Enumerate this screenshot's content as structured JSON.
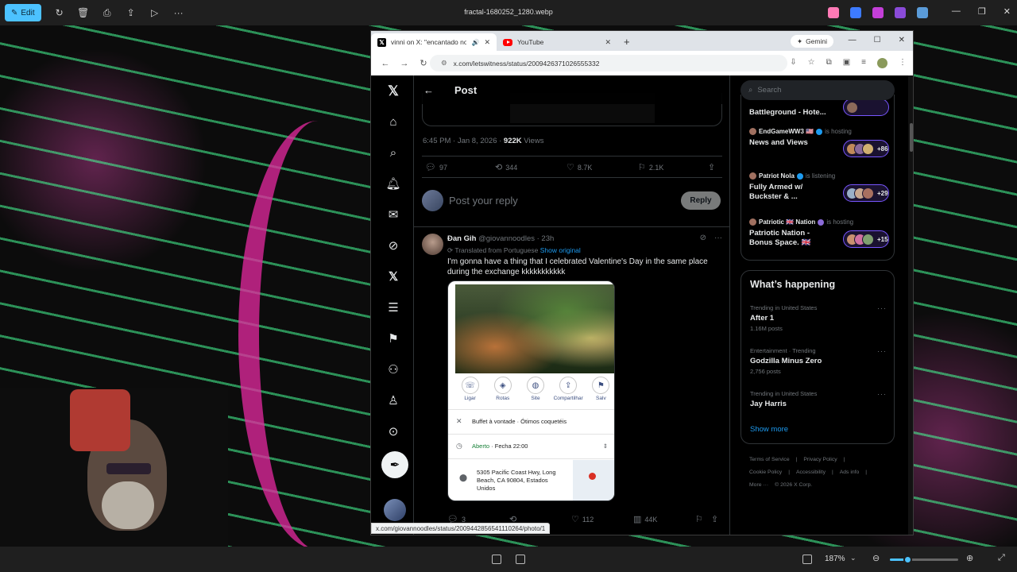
{
  "viewer": {
    "edit_label": "Edit",
    "file_title": "fractal-1680252_1280.webp",
    "zoom_label": "187%",
    "zoom_level": 0.26,
    "accent": "#4cc2ff"
  },
  "browser": {
    "tabs": [
      {
        "title": "vinni on X: \"encantado no c",
        "active": true
      },
      {
        "title": "YouTube",
        "active": false
      }
    ],
    "gemini_label": "Gemini",
    "url": "x.com/letswitness/status/2009426371026555332",
    "status_url": "x.com/giovannoodles/status/2009442856541110264/photo/1"
  },
  "post": {
    "header_title": "Post",
    "time": "6:45 PM · Jan 8, 2026 · ",
    "views_count": "922K",
    "views_label": " Views",
    "stats": {
      "replies": "97",
      "reposts": "344",
      "likes": "8.7K",
      "bookmarks": "2.1K"
    },
    "reply_placeholder": "Post your reply",
    "reply_button": "Reply"
  },
  "reply_tweet": {
    "name": "Đan Gih",
    "handle": "@giovannoodles",
    "age": " · 23h",
    "translated": "Translated from Portuguese",
    "show_original": "Show original",
    "text": "I'm gonna have a thing that I celebrated Valentine's Day in the same place during the exchange kkkkkkkkkkk",
    "map_card": {
      "actions": [
        "Ligar",
        "Rotas",
        "Site",
        "Compartilhar",
        "Salv"
      ],
      "category": "Buffet à vontade · Ótimos coquetéis",
      "open": "Aberto",
      "closes": " · Fecha 22:00",
      "address": "5305 Pacific Coast Hwy, Long Beach, CA 90804, Estados Unidos"
    },
    "stats": {
      "replies": "3",
      "likes": "112",
      "views": "44K"
    }
  },
  "spaces": [
    {
      "host": "",
      "status": "",
      "title": "Battleground - Hote...",
      "count": ""
    },
    {
      "host": "EndGameWW3 🇺🇸",
      "status": "is hosting",
      "title": "News and Views",
      "count": "+86"
    },
    {
      "host": "Patriot Nola",
      "status": "is listening",
      "title": "Fully Armed w/ Buckster & ...",
      "count": "+29"
    },
    {
      "host": "Patriotic 🇬🇧 Nation",
      "status": "is hosting",
      "title": "Patriotic Nation - Bonus Space. 🇬🇧",
      "count": "+15"
    }
  ],
  "search_placeholder": "Search",
  "happening": {
    "title": "What’s happening",
    "trends": [
      {
        "context": "Trending in United States",
        "name": "After 1",
        "count": "1.16M posts"
      },
      {
        "context": "Entertainment · Trending",
        "name": "Godzilla Minus Zero",
        "count": "2,756 posts"
      },
      {
        "context": "Trending in United States",
        "name": "Jay Harris",
        "count": ""
      }
    ],
    "show_more": "Show more"
  },
  "footer": [
    "Terms of Service",
    "|",
    "Privacy Policy",
    "|",
    "Cookie Policy",
    "|",
    "Accessibility",
    "|",
    "Ads info",
    "|",
    "More ···",
    "© 2026 X Corp."
  ]
}
